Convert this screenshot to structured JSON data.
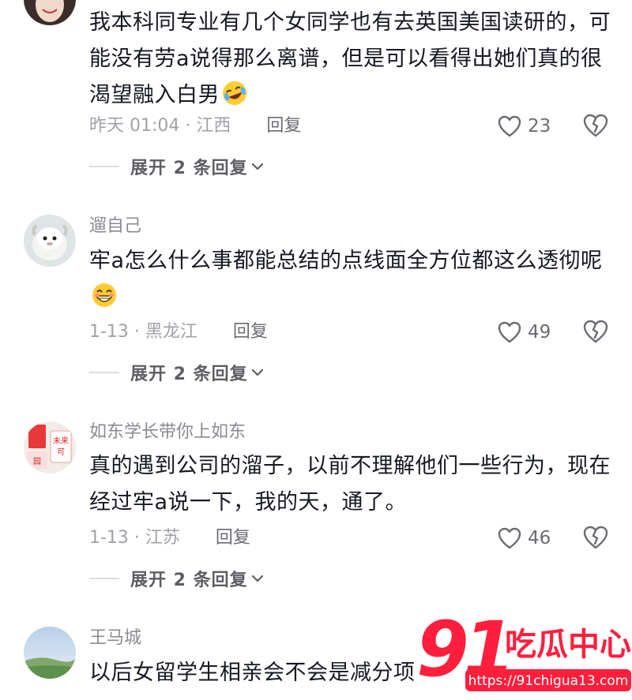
{
  "comments": [
    {
      "username": "",
      "text": "我本科同专业有几个女同学也有去英国美国读研的，可能没有劳a说得那么离谱，但是可以看得出她们真的很渴望融入白男",
      "emoji": "rolling-laugh-emoji",
      "time_location": "昨天 01:04 · 江西",
      "reply_label": "回复",
      "likes": "23",
      "expand_label": "展开 2 条回复"
    },
    {
      "username": "遛自己",
      "text": "牢a怎么什么事都能总结的点线面全方位都这么透彻呢",
      "emoji": "grin-emoji",
      "time_location": "1-13 · 黑龙江",
      "reply_label": "回复",
      "likes": "49",
      "expand_label": "展开 2 条回复"
    },
    {
      "username": "如东学长带你上如东",
      "text": "真的遇到公司的溜子，以前不理解他们一些行为，现在经过牢a说一下，我的天，通了。",
      "emoji": "",
      "time_location": "1-13 · 江苏",
      "reply_label": "回复",
      "likes": "46",
      "expand_label": "展开 2 条回复"
    },
    {
      "username": "王马城",
      "text": "以后女留学生相亲会不会是减分项",
      "emoji": "",
      "time_location": "",
      "reply_label": "",
      "likes": "",
      "expand_label": ""
    }
  ],
  "watermark": {
    "number": "91",
    "brand": "吃瓜中心",
    "url": "https://91chigua13.com"
  },
  "colors": {
    "text": "#161823",
    "muted": "#a1a2a8",
    "username": "#8a8b91",
    "watermark_red": "#ff1f3d"
  }
}
